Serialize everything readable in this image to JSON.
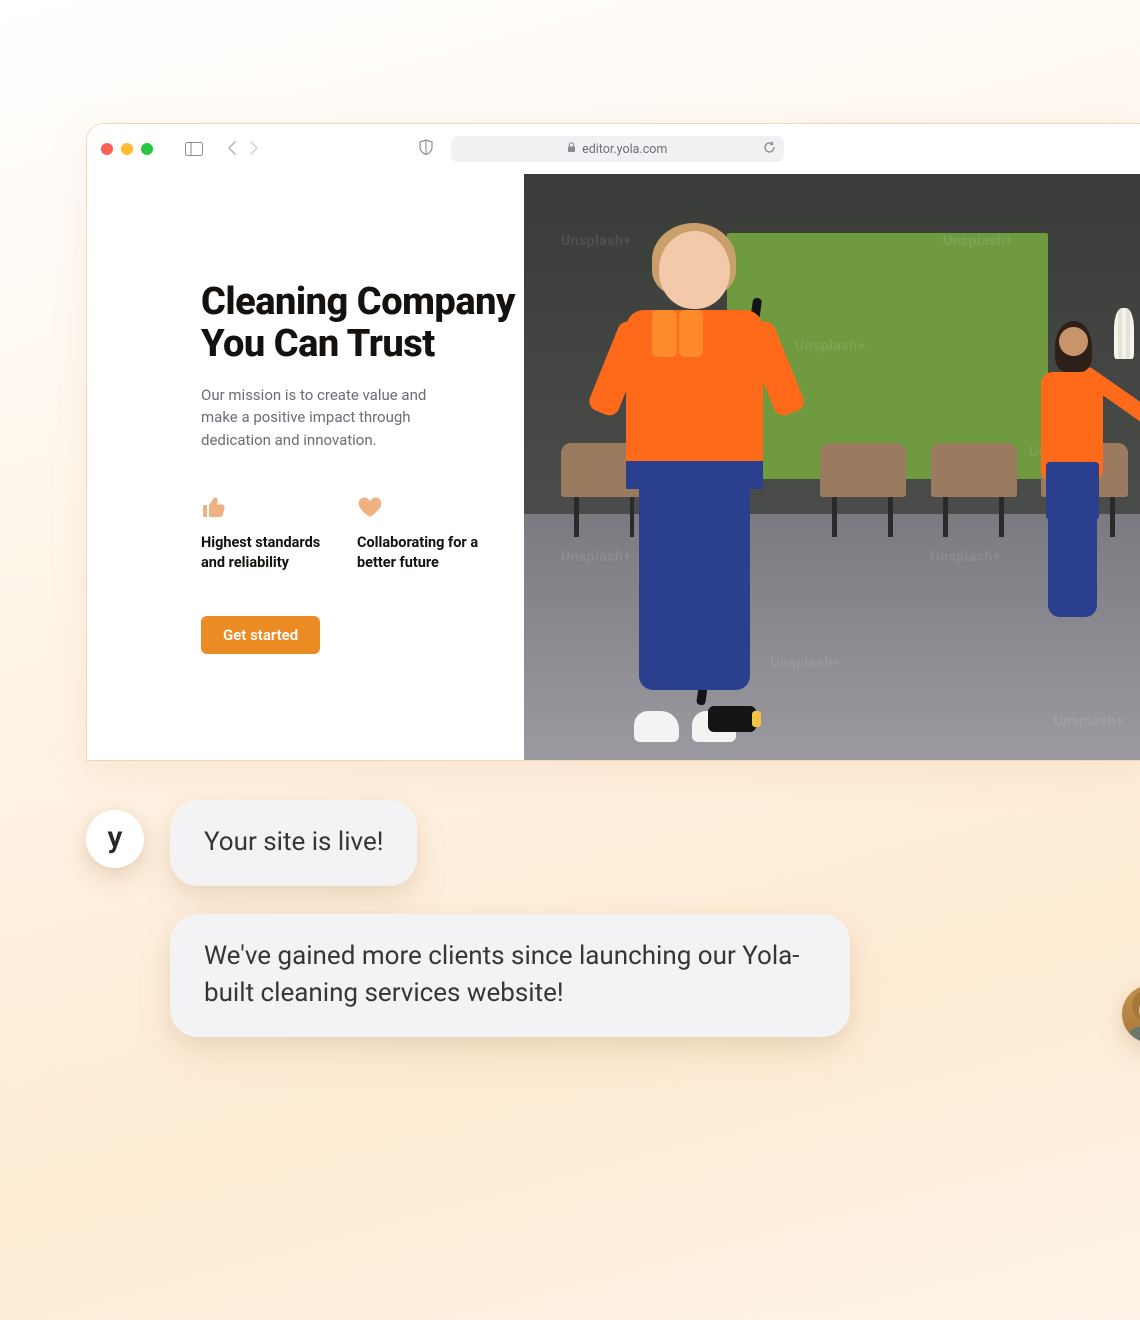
{
  "browser": {
    "url_host": "editor.yola.com"
  },
  "hero": {
    "title": "Cleaning Company You Can Trust",
    "subtitle": "Our mission is to create value and make a positive impact through dedication and innovation.",
    "cta_label": "Get started",
    "features": [
      {
        "icon": "thumbs-up-icon",
        "title": "Highest standards and reliability"
      },
      {
        "icon": "heart-icon",
        "title": "Collaborating for a better future"
      }
    ]
  },
  "image_watermark": "Unsplash+",
  "chat": {
    "yola_initial": "y",
    "bubble1": "Your site is live!",
    "bubble2": "We've gained more clients since launching our Yola-built cleaning services website!"
  },
  "colors": {
    "primary": "#ea8b24",
    "feature_icon": "#f0b181"
  }
}
